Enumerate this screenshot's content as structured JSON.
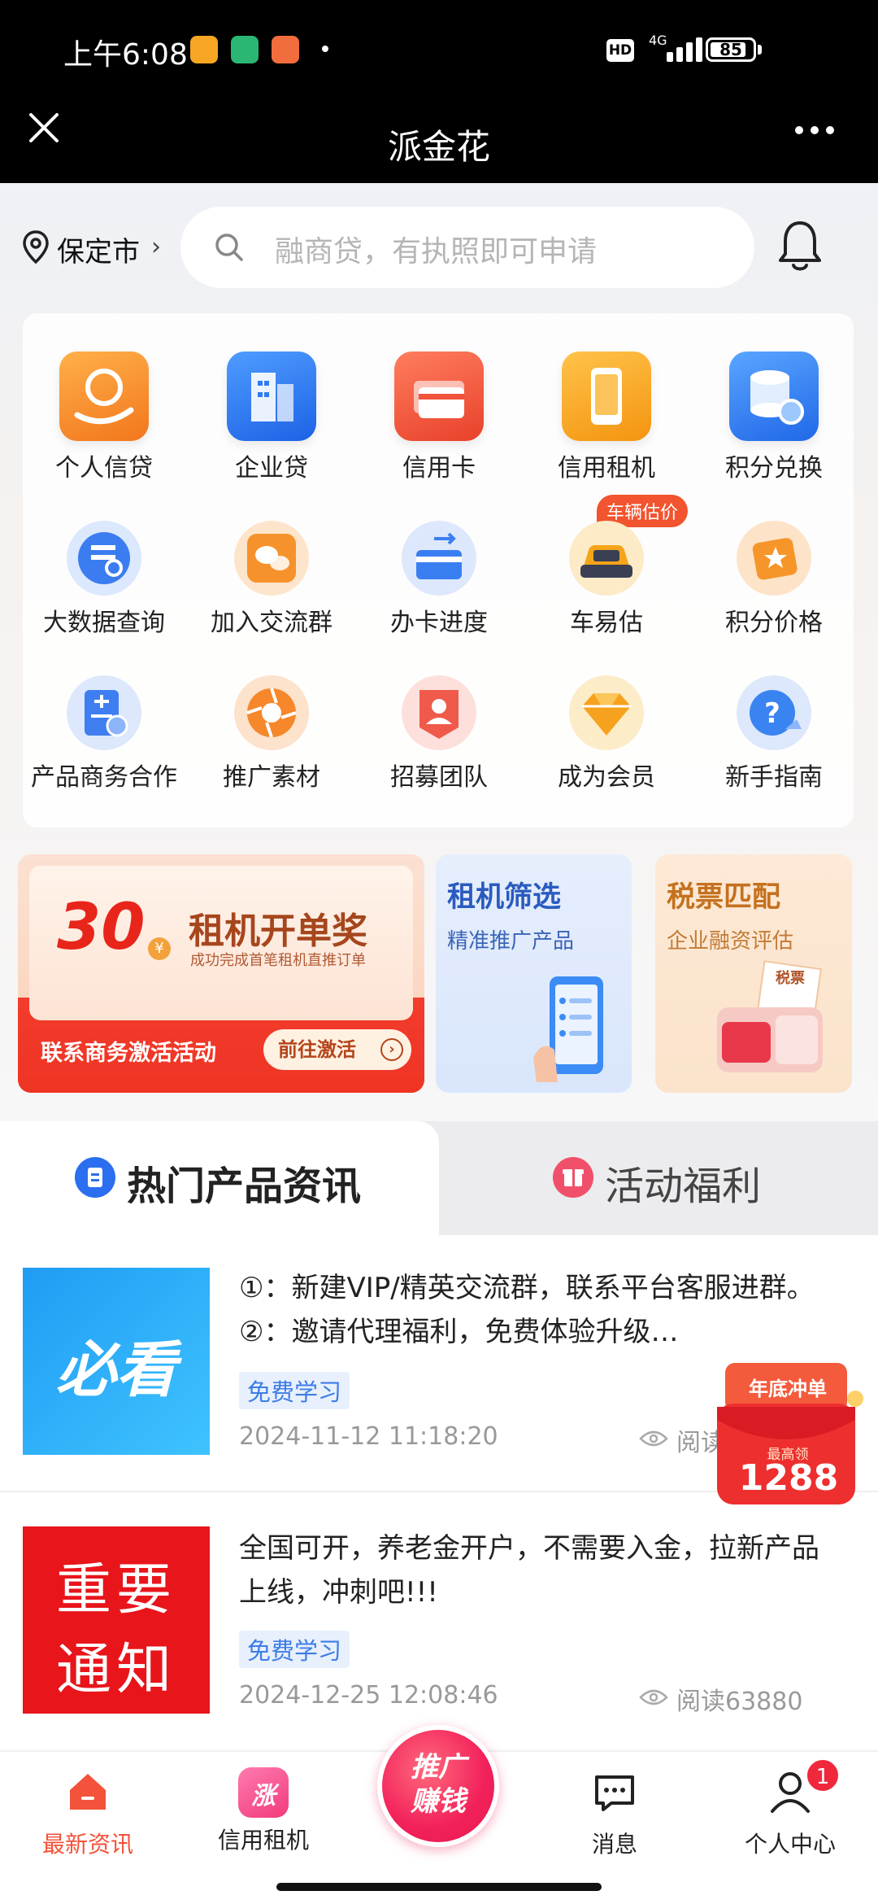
{
  "status": {
    "time": "上午6:08",
    "hd": "HD",
    "network": "4G",
    "battery": "85",
    "battery_level": 0.85
  },
  "header": {
    "title": "派金花"
  },
  "location": {
    "city": "保定市"
  },
  "search": {
    "placeholder": "融商贷，有执照即可申请"
  },
  "grid": {
    "row1": [
      {
        "label": "个人信贷",
        "icon": "person-loan-icon",
        "color": "#f7892a"
      },
      {
        "label": "企业贷",
        "icon": "building-icon",
        "color": "#2f7df1"
      },
      {
        "label": "信用卡",
        "icon": "credit-card-icon",
        "color": "#f0543a"
      },
      {
        "label": "信用租机",
        "icon": "phone-rent-icon",
        "color": "#f8a51e"
      },
      {
        "label": "积分兑换",
        "icon": "database-icon",
        "color": "#3a86f3"
      }
    ],
    "row2": [
      {
        "label": "大数据查询",
        "icon": "data-search-icon",
        "color": "#3b7cf0"
      },
      {
        "label": "加入交流群",
        "icon": "chat-group-icon",
        "color": "#f6922c"
      },
      {
        "label": "办卡进度",
        "icon": "card-progress-icon",
        "color": "#3a7ff2"
      },
      {
        "label": "车易估",
        "icon": "car-icon",
        "color": "#f6a519"
      },
      {
        "label": "积分价格",
        "icon": "star-tag-icon",
        "color": "#f6962a"
      }
    ],
    "row3": [
      {
        "label": "产品商务合作",
        "icon": "cooperation-icon",
        "color": "#3e7ef0"
      },
      {
        "label": "推广素材",
        "icon": "aperture-icon",
        "color": "#f6872a"
      },
      {
        "label": "招募团队",
        "icon": "team-icon",
        "color": "#f05a4a"
      },
      {
        "label": "成为会员",
        "icon": "diamond-icon",
        "color": "#f7a21e"
      },
      {
        "label": "新手指南",
        "icon": "question-icon",
        "color": "#3a84f2"
      }
    ],
    "car_badge": "车辆估价"
  },
  "banners": {
    "b1": {
      "amount": "30",
      "yen": "¥",
      "title": "租机开单奖",
      "subtitle": "成功完成首笔租机直推订单",
      "bottom": "联系商务激活活动",
      "button": "前往激活"
    },
    "b2": {
      "title": "租机筛选",
      "subtitle": "精准推广产品"
    },
    "b3": {
      "title": "税票匹配",
      "subtitle": "企业融资评估",
      "stamp": "税票"
    }
  },
  "tabs": {
    "active": "热门产品资讯",
    "other": "活动福利"
  },
  "articles": [
    {
      "thumb": "必看",
      "title": "①：新建VIP/精英交流群，联系平台客服进群。②：邀请代理福利，免费体验升级…",
      "tag": "免费学习",
      "date": "2024-11-12 11:18:20",
      "read": "阅读"
    },
    {
      "thumb_line1": "重要",
      "thumb_line2": "通知",
      "title": "全国可开，养老金开户，不需要入金，拉新产品上线，冲刺吧!!!",
      "tag": "免费学习",
      "date": "2024-12-25 12:08:46",
      "read": "阅读63880"
    }
  ],
  "promo": {
    "top": "年底冲单",
    "mid": "最高领",
    "amount": "1288"
  },
  "nav": {
    "home": "最新资讯",
    "rent": "信用租机",
    "rent_badge": "涨",
    "center_line1": "推广",
    "center_line2": "赚钱",
    "messages": "消息",
    "profile": "个人中心",
    "profile_badge": "1"
  },
  "colors": {
    "accent": "#f2533a",
    "brand_blue": "#2b6ff0",
    "tag_blue": "#3d7de6"
  }
}
